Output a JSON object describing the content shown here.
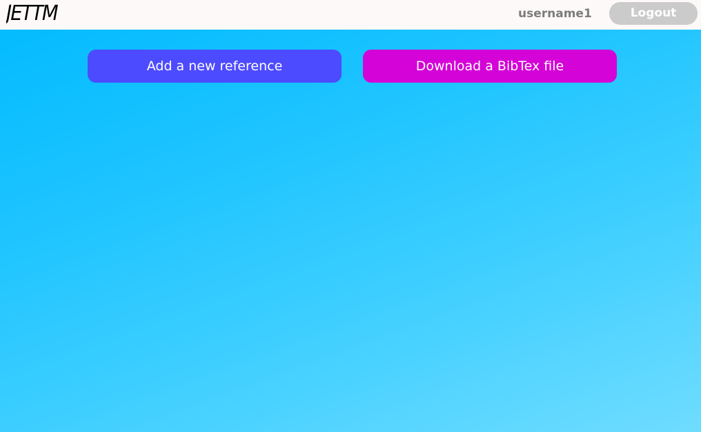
{
  "navbar": {
    "logo_text": "JETTM",
    "username": "username1",
    "logout_label": "Logout"
  },
  "actions": {
    "add_reference_label": "Add a new reference",
    "download_bibtex_label": "Download a BibTex file"
  },
  "colors": {
    "navbar_background": "#fdf9f8",
    "page_gradient_start": "#00baff",
    "page_gradient_end": "#6fdcff",
    "add_button": "#4d4bff",
    "download_button": "#d403d7",
    "logout_button": "#cbcbcb",
    "username_text": "#7c7c7c"
  }
}
